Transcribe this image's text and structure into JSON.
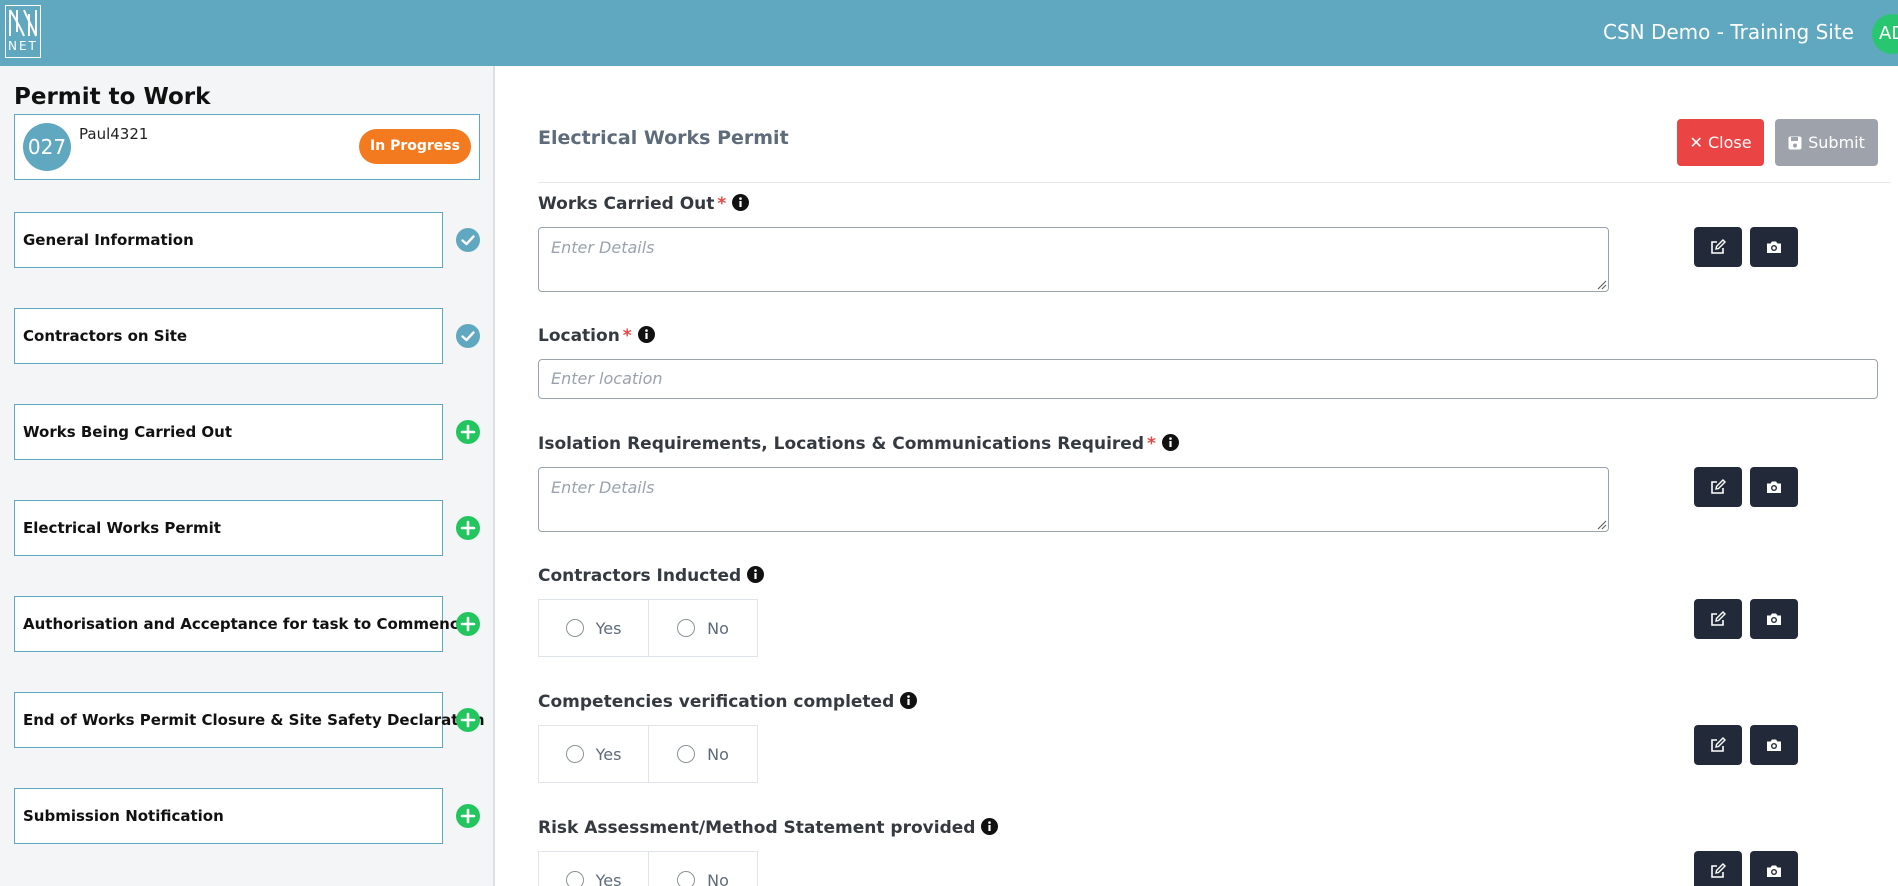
{
  "header": {
    "logo_text": "NET",
    "site_name": "CSN Demo - Training Site",
    "avatar_initials": "AD",
    "avatar_color": "#28c76f",
    "bar_color": "#60a8c0"
  },
  "sidebar": {
    "title": "Permit to Work",
    "permit": {
      "number": "027",
      "user": "Paul4321",
      "status": "In Progress",
      "status_color": "#f47a20"
    },
    "sections": [
      {
        "label": "General Information",
        "state": "complete",
        "icon": "check-circle-icon"
      },
      {
        "label": "Contractors on Site",
        "state": "complete",
        "icon": "check-circle-icon"
      },
      {
        "label": "Works Being Carried Out",
        "state": "add",
        "icon": "plus-circle-icon"
      },
      {
        "label": "Electrical Works Permit",
        "state": "add",
        "icon": "plus-circle-icon"
      },
      {
        "label": "Authorisation and Acceptance for task to Commence",
        "state": "add",
        "icon": "plus-circle-icon"
      },
      {
        "label": "End of Works Permit Closure & Site Safety Declaration",
        "state": "add",
        "icon": "plus-circle-icon"
      },
      {
        "label": "Submission Notification",
        "state": "add",
        "icon": "plus-circle-icon"
      }
    ]
  },
  "main": {
    "title": "Electrical Works Permit",
    "close_label": "Close",
    "submit_label": "Submit",
    "fields": {
      "works_carried_out": {
        "label": "Works Carried Out",
        "required": "*",
        "placeholder": "Enter Details"
      },
      "location": {
        "label": "Location",
        "required": "*",
        "placeholder": "Enter location"
      },
      "isolation": {
        "label": "Isolation Requirements, Locations & Communications Required",
        "required": "*",
        "placeholder": "Enter Details"
      },
      "contractors_inducted": {
        "label": "Contractors Inducted",
        "yes": "Yes",
        "no": "No"
      },
      "competencies": {
        "label": "Competencies verification completed",
        "yes": "Yes",
        "no": "No"
      },
      "risk_assessment": {
        "label": "Risk Assessment/Method Statement provided",
        "yes": "Yes",
        "no": "No"
      }
    }
  }
}
